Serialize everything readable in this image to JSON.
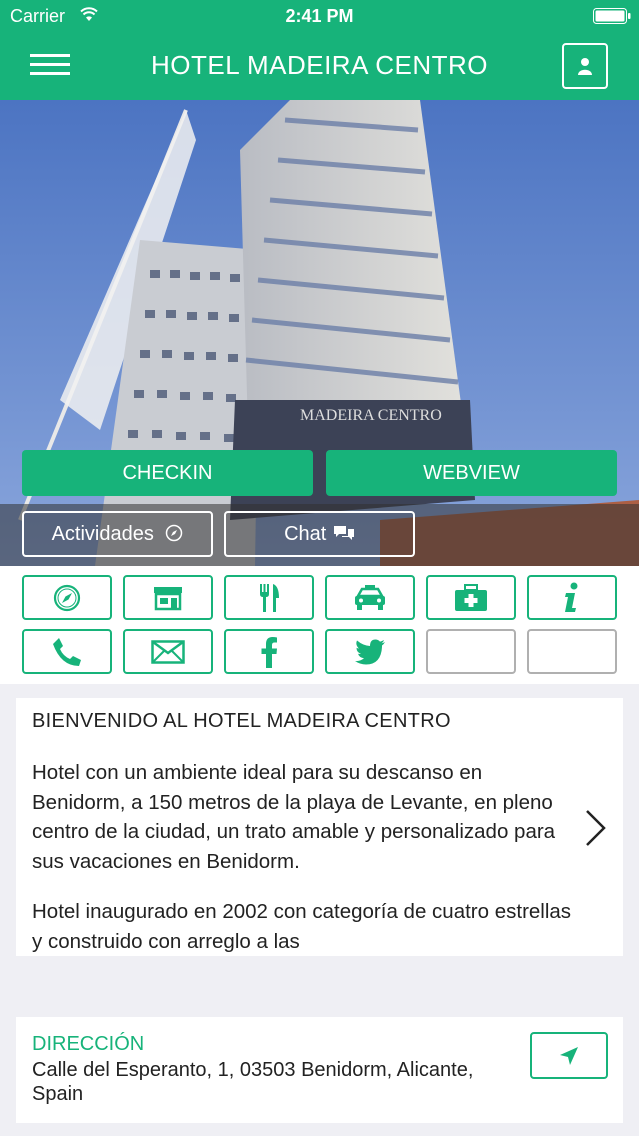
{
  "status_bar": {
    "carrier": "Carrier",
    "time": "2:41 PM"
  },
  "header": {
    "title": "HOTEL MADEIRA CENTRO"
  },
  "hero": {
    "checkin_label": "CHECKIN",
    "webview_label": "WEBVIEW",
    "actividades_label": "Actividades",
    "chat_label": "Chat",
    "sign_text": "MADEIRA CENTRO"
  },
  "grid_icons": [
    "compass-icon",
    "store-icon",
    "restaurant-icon",
    "taxi-icon",
    "first-aid-icon",
    "info-icon",
    "phone-icon",
    "mail-icon",
    "facebook-icon",
    "twitter-icon",
    "empty",
    "empty"
  ],
  "welcome": {
    "heading": "BIENVENIDO AL HOTEL MADEIRA CENTRO",
    "paragraphs": [
      "Hotel con un ambiente ideal para su descanso en Benidorm, a 150 metros de la playa de Levante, en pleno centro de la ciudad, un trato amable y personalizado para sus vacaciones en Benidorm.",
      "Hotel inaugurado en 2002 con categoría de cuatro estrellas y construido con arreglo a las"
    ]
  },
  "address": {
    "label": "DIRECCIÓN",
    "value": "Calle del Esperanto, 1, 03503 Benidorm, Alicante, Spain"
  },
  "colors": {
    "brand": "#17b37a",
    "background": "#efeff4"
  }
}
